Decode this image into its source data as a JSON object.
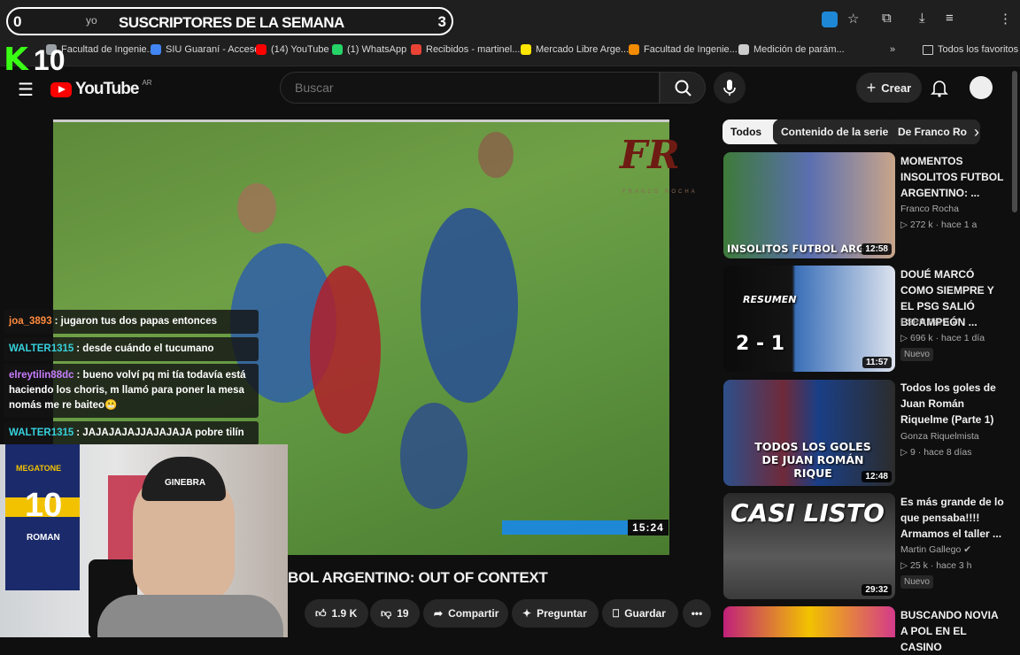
{
  "overlay": {
    "subs_left_count": "0",
    "subs_title": "SUSCRIPTORES DE LA SEMANA",
    "subs_right_count": "3",
    "url_fragment": "yo",
    "k_logo": "K",
    "viewer_count": "10"
  },
  "bookmarks": [
    {
      "label": "Facultad de Ingenie...",
      "color": "#9aa0a6"
    },
    {
      "label": "SIU Guaraní - Acceso",
      "color": "#4285f4"
    },
    {
      "label": "(14) YouTube",
      "color": "#ff0000"
    },
    {
      "label": "(1) WhatsApp",
      "color": "#25d366"
    },
    {
      "label": "Recibidos - martinel...",
      "color": "#ea4335"
    },
    {
      "label": "Mercado Libre Arge...",
      "color": "#ffe600"
    },
    {
      "label": "Facultad de Ingenie...",
      "color": "#f28b00"
    },
    {
      "label": "Medición de parám...",
      "color": "#cccccc"
    }
  ],
  "bookmarks_more": "»",
  "all_bookmarks": "Todos los favoritos",
  "youtube": {
    "logo_text": "YouTube",
    "region": "AR",
    "search_placeholder": "Buscar",
    "create_label": "Crear"
  },
  "video": {
    "watermark": "FR",
    "watermark_sub": "FRANCO ROCHA",
    "time": "15:24",
    "title": "BOL ARGENTINO: OUT OF CONTEXT",
    "likes": "1.9 K",
    "dislikes": "19",
    "share": "Compartir",
    "ask": "Preguntar",
    "save": "Guardar"
  },
  "chat": [
    {
      "user": "joa_3893",
      "color": "#ff8a3d",
      "text": ": jugaron tus dos papas entonces"
    },
    {
      "user": "WALTER1315",
      "color": "#36d1dc",
      "text": ": desde cuándo el tucumano"
    },
    {
      "user": "elreytilin88dc",
      "color": "#c77dff",
      "text": ": bueno volví pq mi tía todavía está haciendo los choris, m llamó para poner la mesa nomás me re baiteo😬"
    },
    {
      "user": "WALTER1315",
      "color": "#36d1dc",
      "text": ": JAJAJAJAJJAJAJAJA pobre tilín"
    }
  ],
  "webcam": {
    "cap_text": "GINEBRA",
    "shirt_brand": "MEGATONE",
    "shirt_number": "10",
    "shirt_name": "ROMAN"
  },
  "chips": [
    "Todos",
    "Contenido de la serie",
    "De Franco Ro"
  ],
  "related": [
    {
      "title": "MOMENTOS INSOLITOS FUTBOL ARGENTINO: ...",
      "channel": "Franco Rocha",
      "views": "272 k",
      "age": "hace 1 a",
      "duration": "12:58",
      "thumb_text": "INSOLITOS FUTBOL ARGEN",
      "badge": "",
      "verified": false
    },
    {
      "title": "DOUÉ MARCÓ COMO SIEMPRE Y EL PSG SALIÓ BICAMPEÓN ...",
      "channel": "ESPN Fans",
      "views": "696 k",
      "age": "hace 1 día",
      "duration": "11:57",
      "thumb_text": "RESUMEN",
      "badge": "Nuevo",
      "verified": true,
      "score": "2 - 1"
    },
    {
      "title": "Todos los goles de Juan Román Riquelme (Parte 1)",
      "channel": "Gonza Riquelmista",
      "views": "9",
      "age": "hace 8 días",
      "duration": "12:48",
      "thumb_text": "TODOS LOS GOLES DE JUAN ROMÁN RIQUE",
      "badge": "",
      "verified": false
    },
    {
      "title": "Es más grande de lo que pensaba!!!! Armamos el taller ...",
      "channel": "Martin Gallego",
      "views": "25 k",
      "age": "hace 3 h",
      "duration": "29:32",
      "thumb_text": "CASI LISTO",
      "badge": "Nuevo",
      "verified": true
    },
    {
      "title": "BUSCANDO NOVIA A POL EN EL CASINO",
      "channel": "",
      "views": "",
      "age": "",
      "duration": "",
      "thumb_text": "",
      "badge": "",
      "verified": false
    }
  ]
}
